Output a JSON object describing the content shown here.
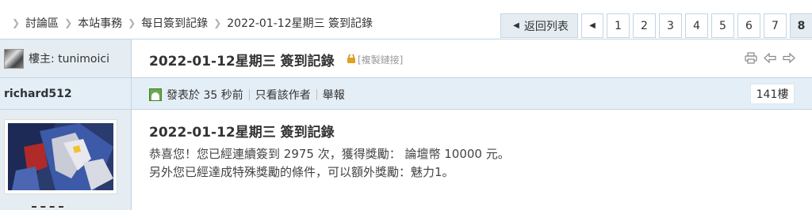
{
  "breadcrumb": {
    "items": [
      "討論區",
      "本站事務",
      "每日簽到記錄",
      "2022-01-12星期三 簽到記錄"
    ]
  },
  "pager": {
    "back_label": "返回列表",
    "pages": [
      "1",
      "2",
      "3",
      "4",
      "5",
      "6",
      "7",
      "8"
    ],
    "current_page": "8"
  },
  "thread": {
    "op_prefix": "樓主: ",
    "op_name": "tunimoici",
    "title": "2022-01-12星期三 簽到記錄",
    "copy_link_label": "[複製鏈接]",
    "tools": [
      "printer-icon",
      "previous-thread-icon",
      "next-thread-icon"
    ]
  },
  "post": {
    "author": "richard512",
    "posted_time": "發表於 35 秒前",
    "only_author_label": "只看該作者",
    "report_label": "舉報",
    "floor": "141樓",
    "title": "2022-01-12星期三 簽到記錄",
    "line1": "恭喜您！您已經連續簽到 2975 次，獲得獎勵： 論壇幣 10000 元。",
    "line2": "另外您已經達成特殊獎勵的條件，可以額外獎勵：魅力1。"
  },
  "colors": {
    "header_bg": "#e5edf2",
    "post_header_bg": "#e3eef6",
    "border": "#c2d5e3",
    "online_icon": "#6aa84f",
    "lock": "#e0a020"
  }
}
